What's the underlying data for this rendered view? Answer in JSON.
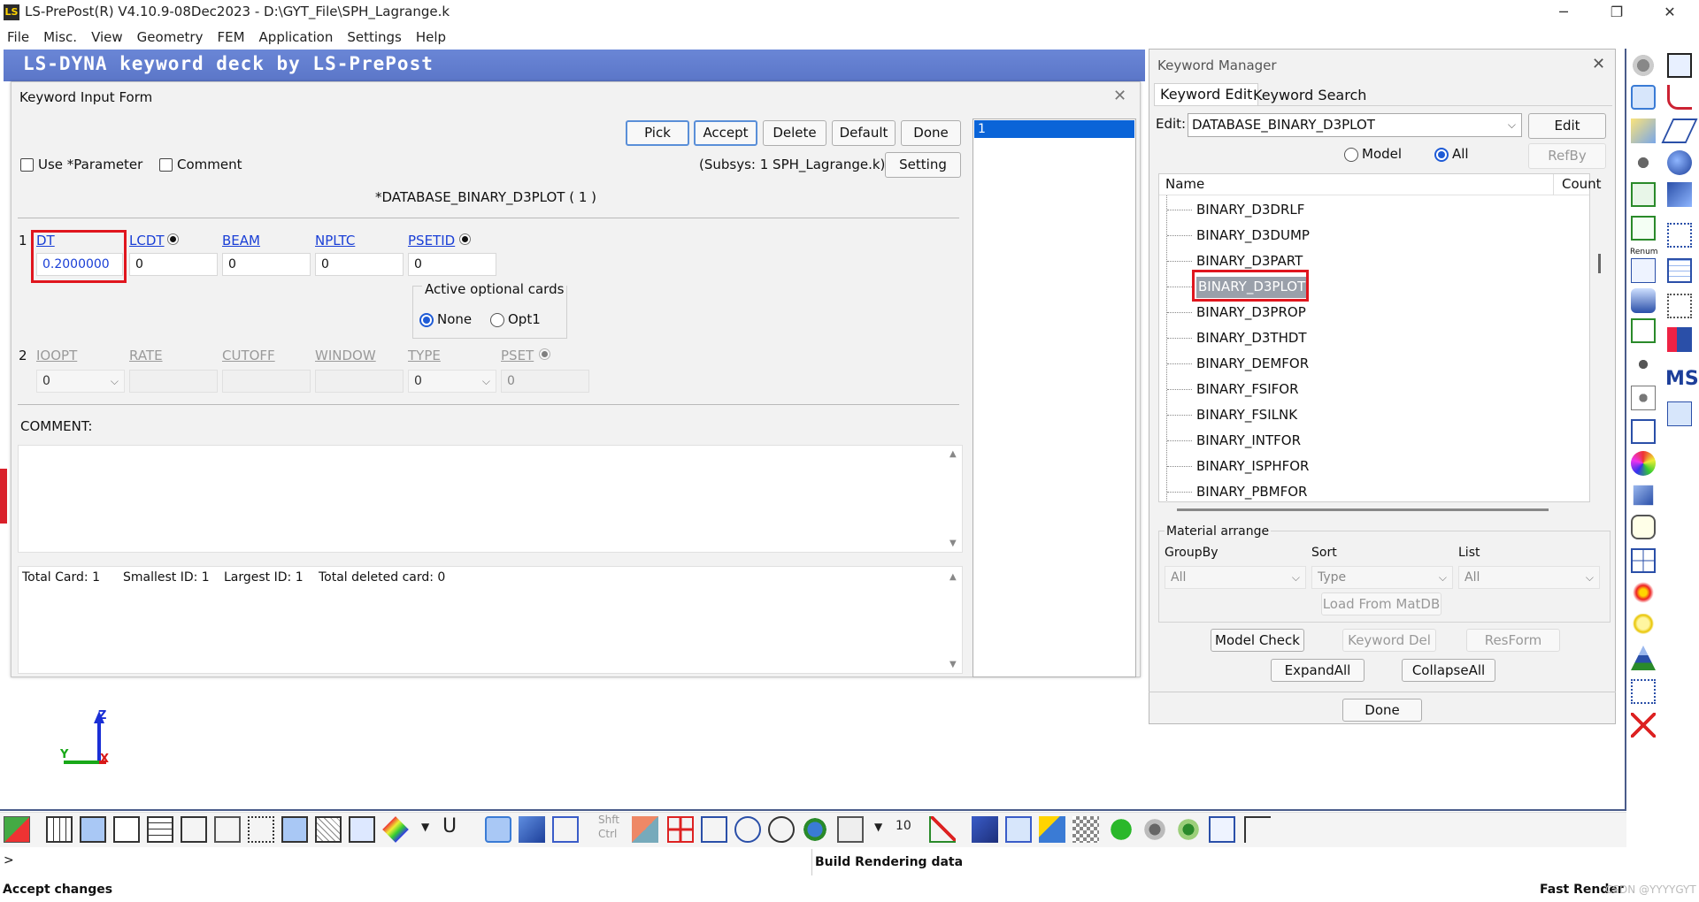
{
  "window": {
    "title": "LS-PrePost(R) V4.10.9-08Dec2023 - D:\\GYT_File\\SPH_Lagrange.k",
    "icon_label": "LS",
    "minimize": "─",
    "maximize": "❐",
    "close": "✕"
  },
  "menu": [
    "File",
    "Misc.",
    "View",
    "Geometry",
    "FEM",
    "Application",
    "Settings",
    "Help"
  ],
  "deck_title": "LS-DYNA keyword deck by LS-PrePost",
  "keyword_form": {
    "title": "Keyword Input Form",
    "buttons": {
      "pick": "Pick",
      "accept": "Accept",
      "delete": "Delete",
      "default": "Default",
      "done": "Done",
      "setting": "Setting"
    },
    "use_parameter": "Use *Parameter",
    "comment_check": "Comment",
    "subsys": "(Subsys: 1 SPH_Lagrange.k)",
    "keyword_heading": "*DATABASE_BINARY_D3PLOT   ( 1 )",
    "card1": {
      "number": "1",
      "fields": [
        {
          "label": "DT",
          "value": "0.2000000"
        },
        {
          "label": "LCDT",
          "value": "0"
        },
        {
          "label": "BEAM",
          "value": "0"
        },
        {
          "label": "NPLTC",
          "value": "0"
        },
        {
          "label": "PSETID",
          "value": "0"
        }
      ]
    },
    "optional_cards": {
      "title": "Active optional cards",
      "none": "None",
      "opt1": "Opt1"
    },
    "card2": {
      "number": "2",
      "fields": [
        {
          "label": "IOOPT",
          "value": "0"
        },
        {
          "label": "RATE",
          "value": ""
        },
        {
          "label": "CUTOFF",
          "value": ""
        },
        {
          "label": "WINDOW",
          "value": ""
        },
        {
          "label": "TYPE",
          "value": "0"
        },
        {
          "label": "PSET",
          "value": "0"
        }
      ]
    },
    "comment_label": "COMMENT:",
    "summary": {
      "total_card": "Total Card: 1",
      "smallest_id": "Smallest ID: 1",
      "largest_id": "Largest ID: 1",
      "total_deleted": "Total deleted card:  0"
    },
    "id_list": [
      "1"
    ]
  },
  "keyword_manager": {
    "title": "Keyword Manager",
    "tabs": [
      "Keyword Edit",
      "Keyword Search"
    ],
    "edit_label": "Edit:",
    "edit_value": "DATABASE_BINARY_D3PLOT",
    "edit_button": "Edit",
    "radio_model": "Model",
    "radio_all": "All",
    "refby": "RefBy",
    "col_name": "Name",
    "col_count": "Count",
    "items": [
      "BINARY_D3DRLF",
      "BINARY_D3DUMP",
      "BINARY_D3PART",
      "BINARY_D3PLOT",
      "BINARY_D3PROP",
      "BINARY_D3THDT",
      "BINARY_DEMFOR",
      "BINARY_FSIFOR",
      "BINARY_FSILNK",
      "BINARY_INTFOR",
      "BINARY_ISPHFOR",
      "BINARY_PBMFOR"
    ],
    "selected_item": "BINARY_D3PLOT",
    "material": {
      "title": "Material arrange",
      "groupby_label": "GroupBy",
      "groupby_value": "All",
      "sort_label": "Sort",
      "sort_value": "Type",
      "list_label": "List",
      "list_value": "All",
      "load_button": "Load From MatDB"
    },
    "buttons": {
      "model_check": "Model Check",
      "keyword_del": "Keyword Del",
      "resform": "ResForm",
      "expand_all": "ExpandAll",
      "collapse_all": "CollapseAll",
      "done": "Done"
    }
  },
  "axes": {
    "z": "Z",
    "y": "Y",
    "x": "X"
  },
  "bottom_toolbar": {
    "shft": "Shft",
    "ctrl": "Ctrl",
    "count": "10",
    "u_label": "U"
  },
  "command_prompt": ">",
  "render_message": "Build Rendering data",
  "status": {
    "left": "Accept changes",
    "right": "Fast Render"
  },
  "watermark": "CSDN @YYYYGYT",
  "right_toolbar": {
    "ms_label": "MS",
    "renum_label": "Renum"
  },
  "colors": {
    "banner": "#5b76c8",
    "selection": "#0a64d8",
    "highlight_box": "#e0161e",
    "link": "#1a3fd6"
  }
}
